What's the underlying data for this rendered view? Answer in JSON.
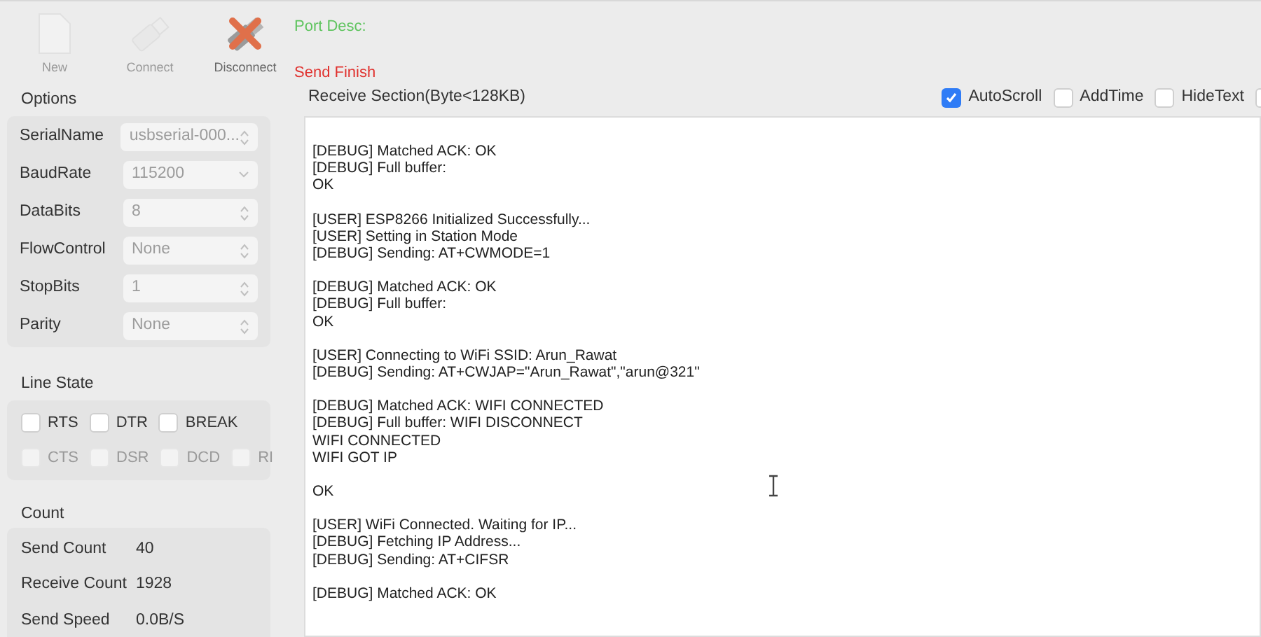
{
  "toolbar": [
    {
      "label": "New",
      "kind": "file",
      "disabled": true
    },
    {
      "label": "Connect",
      "kind": "usb",
      "disabled": true
    },
    {
      "label": "Disconnect",
      "kind": "disconnect",
      "disabled": false
    }
  ],
  "port_desc": "Port Desc:",
  "send_status": "Send Finish",
  "options": {
    "title": "Options",
    "fields": [
      {
        "label": "SerialName",
        "value": "usbserial-000...",
        "kind": "stepper"
      },
      {
        "label": "BaudRate",
        "value": "115200",
        "kind": "combo"
      },
      {
        "label": "DataBits",
        "value": "8",
        "kind": "stepper"
      },
      {
        "label": "FlowControl",
        "value": "None",
        "kind": "stepper"
      },
      {
        "label": "StopBits",
        "value": "1",
        "kind": "stepper"
      },
      {
        "label": "Parity",
        "value": "None",
        "kind": "stepper"
      }
    ]
  },
  "line_state": {
    "title": "Line State",
    "rows": [
      [
        {
          "label": "RTS",
          "checked": false,
          "disabled": false
        },
        {
          "label": "DTR",
          "checked": false,
          "disabled": false
        },
        {
          "label": "BREAK",
          "checked": false,
          "disabled": false
        }
      ],
      [
        {
          "label": "CTS",
          "checked": false,
          "disabled": true
        },
        {
          "label": "DSR",
          "checked": false,
          "disabled": true
        },
        {
          "label": "DCD",
          "checked": false,
          "disabled": true
        },
        {
          "label": "RI",
          "checked": false,
          "disabled": true
        }
      ]
    ]
  },
  "count": {
    "title": "Count",
    "rows": [
      {
        "label": "Send Count",
        "value": "40"
      },
      {
        "label": "Receive Count",
        "value": "1928"
      },
      {
        "label": "Send Speed",
        "value": "0.0B/S"
      }
    ]
  },
  "receive": {
    "title": "Receive Section(Byte<128KB)",
    "options": [
      {
        "label": "AutoScroll",
        "checked": true
      },
      {
        "label": "AddTime",
        "checked": false
      },
      {
        "label": "HideText",
        "checked": false
      },
      {
        "checked": false
      }
    ],
    "blocks": [
      [
        "[DEBUG] Matched ACK: OK",
        "[DEBUG] Full buffer:",
        "OK"
      ],
      [
        "[USER] ESP8266 Initialized Successfully...",
        "[USER] Setting in Station Mode",
        "[DEBUG] Sending: AT+CWMODE=1"
      ],
      [
        "[DEBUG] Matched ACK: OK",
        "[DEBUG] Full buffer:",
        "OK"
      ],
      [
        "[USER] Connecting to WiFi SSID: Arun_Rawat",
        "[DEBUG] Sending: AT+CWJAP=\"Arun_Rawat\",\"arun@321\""
      ],
      [
        "[DEBUG] Matched ACK: WIFI CONNECTED",
        "[DEBUG] Full buffer: WIFI DISCONNECT",
        "WIFI CONNECTED",
        "WIFI GOT IP"
      ],
      [
        "OK"
      ],
      [
        "[USER] WiFi Connected. Waiting for IP...",
        "[DEBUG] Fetching IP Address...",
        "[DEBUG] Sending: AT+CIFSR"
      ],
      [
        "[DEBUG] Matched ACK: OK"
      ]
    ]
  }
}
